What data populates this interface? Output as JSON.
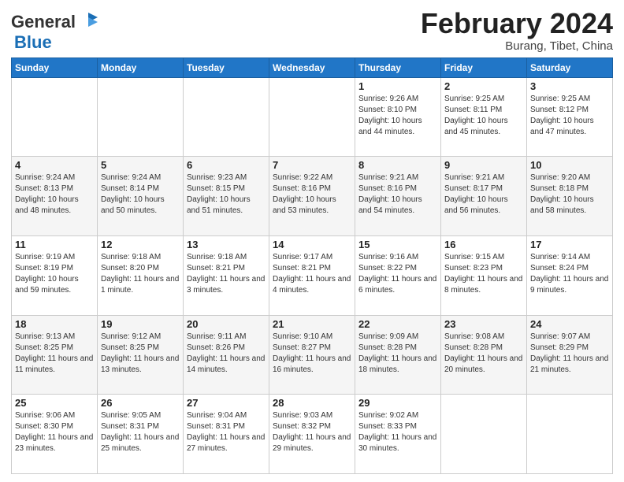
{
  "header": {
    "logo_line1": "General",
    "logo_line2": "Blue",
    "title": "February 2024",
    "location": "Burang, Tibet, China"
  },
  "weekdays": [
    "Sunday",
    "Monday",
    "Tuesday",
    "Wednesday",
    "Thursday",
    "Friday",
    "Saturday"
  ],
  "weeks": [
    [
      {
        "day": "",
        "info": ""
      },
      {
        "day": "",
        "info": ""
      },
      {
        "day": "",
        "info": ""
      },
      {
        "day": "",
        "info": ""
      },
      {
        "day": "1",
        "info": "Sunrise: 9:26 AM\nSunset: 8:10 PM\nDaylight: 10 hours\nand 44 minutes."
      },
      {
        "day": "2",
        "info": "Sunrise: 9:25 AM\nSunset: 8:11 PM\nDaylight: 10 hours\nand 45 minutes."
      },
      {
        "day": "3",
        "info": "Sunrise: 9:25 AM\nSunset: 8:12 PM\nDaylight: 10 hours\nand 47 minutes."
      }
    ],
    [
      {
        "day": "4",
        "info": "Sunrise: 9:24 AM\nSunset: 8:13 PM\nDaylight: 10 hours\nand 48 minutes."
      },
      {
        "day": "5",
        "info": "Sunrise: 9:24 AM\nSunset: 8:14 PM\nDaylight: 10 hours\nand 50 minutes."
      },
      {
        "day": "6",
        "info": "Sunrise: 9:23 AM\nSunset: 8:15 PM\nDaylight: 10 hours\nand 51 minutes."
      },
      {
        "day": "7",
        "info": "Sunrise: 9:22 AM\nSunset: 8:16 PM\nDaylight: 10 hours\nand 53 minutes."
      },
      {
        "day": "8",
        "info": "Sunrise: 9:21 AM\nSunset: 8:16 PM\nDaylight: 10 hours\nand 54 minutes."
      },
      {
        "day": "9",
        "info": "Sunrise: 9:21 AM\nSunset: 8:17 PM\nDaylight: 10 hours\nand 56 minutes."
      },
      {
        "day": "10",
        "info": "Sunrise: 9:20 AM\nSunset: 8:18 PM\nDaylight: 10 hours\nand 58 minutes."
      }
    ],
    [
      {
        "day": "11",
        "info": "Sunrise: 9:19 AM\nSunset: 8:19 PM\nDaylight: 10 hours\nand 59 minutes."
      },
      {
        "day": "12",
        "info": "Sunrise: 9:18 AM\nSunset: 8:20 PM\nDaylight: 11 hours\nand 1 minute."
      },
      {
        "day": "13",
        "info": "Sunrise: 9:18 AM\nSunset: 8:21 PM\nDaylight: 11 hours\nand 3 minutes."
      },
      {
        "day": "14",
        "info": "Sunrise: 9:17 AM\nSunset: 8:21 PM\nDaylight: 11 hours\nand 4 minutes."
      },
      {
        "day": "15",
        "info": "Sunrise: 9:16 AM\nSunset: 8:22 PM\nDaylight: 11 hours\nand 6 minutes."
      },
      {
        "day": "16",
        "info": "Sunrise: 9:15 AM\nSunset: 8:23 PM\nDaylight: 11 hours\nand 8 minutes."
      },
      {
        "day": "17",
        "info": "Sunrise: 9:14 AM\nSunset: 8:24 PM\nDaylight: 11 hours\nand 9 minutes."
      }
    ],
    [
      {
        "day": "18",
        "info": "Sunrise: 9:13 AM\nSunset: 8:25 PM\nDaylight: 11 hours\nand 11 minutes."
      },
      {
        "day": "19",
        "info": "Sunrise: 9:12 AM\nSunset: 8:25 PM\nDaylight: 11 hours\nand 13 minutes."
      },
      {
        "day": "20",
        "info": "Sunrise: 9:11 AM\nSunset: 8:26 PM\nDaylight: 11 hours\nand 14 minutes."
      },
      {
        "day": "21",
        "info": "Sunrise: 9:10 AM\nSunset: 8:27 PM\nDaylight: 11 hours\nand 16 minutes."
      },
      {
        "day": "22",
        "info": "Sunrise: 9:09 AM\nSunset: 8:28 PM\nDaylight: 11 hours\nand 18 minutes."
      },
      {
        "day": "23",
        "info": "Sunrise: 9:08 AM\nSunset: 8:28 PM\nDaylight: 11 hours\nand 20 minutes."
      },
      {
        "day": "24",
        "info": "Sunrise: 9:07 AM\nSunset: 8:29 PM\nDaylight: 11 hours\nand 21 minutes."
      }
    ],
    [
      {
        "day": "25",
        "info": "Sunrise: 9:06 AM\nSunset: 8:30 PM\nDaylight: 11 hours\nand 23 minutes."
      },
      {
        "day": "26",
        "info": "Sunrise: 9:05 AM\nSunset: 8:31 PM\nDaylight: 11 hours\nand 25 minutes."
      },
      {
        "day": "27",
        "info": "Sunrise: 9:04 AM\nSunset: 8:31 PM\nDaylight: 11 hours\nand 27 minutes."
      },
      {
        "day": "28",
        "info": "Sunrise: 9:03 AM\nSunset: 8:32 PM\nDaylight: 11 hours\nand 29 minutes."
      },
      {
        "day": "29",
        "info": "Sunrise: 9:02 AM\nSunset: 8:33 PM\nDaylight: 11 hours\nand 30 minutes."
      },
      {
        "day": "",
        "info": ""
      },
      {
        "day": "",
        "info": ""
      }
    ]
  ]
}
